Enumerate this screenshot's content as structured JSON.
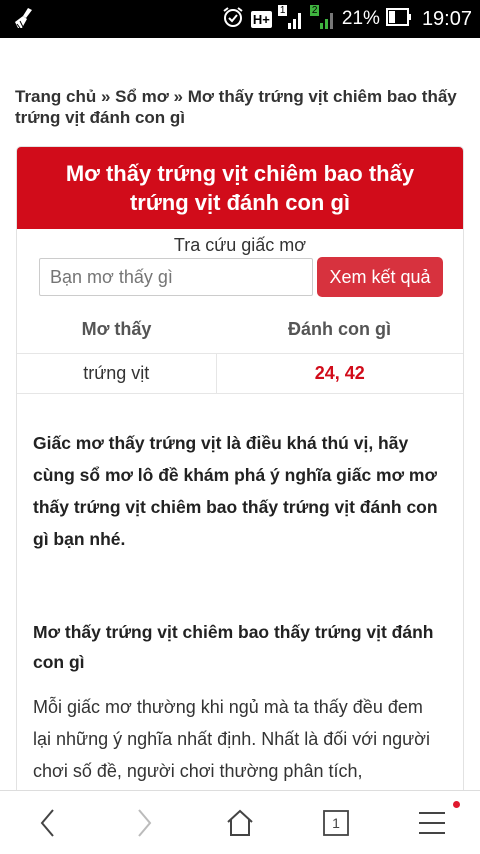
{
  "status_bar": {
    "network": "H+",
    "sim1": "1",
    "sim2": "2",
    "battery": "21%",
    "time": "19:07"
  },
  "breadcrumb": {
    "home": "Trang chủ",
    "sep1": " » ",
    "section": "Sổ mơ",
    "sep2": " » ",
    "current": "Mơ thấy trứng vịt chiêm bao thấy trứng vịt đánh con gì"
  },
  "card": {
    "title": "Mơ thấy trứng vịt chiêm bao thấy trứng vịt đánh con gì",
    "search_label": "Tra cứu giấc mơ",
    "search_placeholder": "Bạn mơ thấy gì",
    "search_button": "Xem kết quả"
  },
  "table": {
    "headers": [
      "Mơ thấy",
      "Đánh con gì"
    ],
    "rows": [
      {
        "dream": "trứng vịt",
        "numbers": "24, 42"
      }
    ]
  },
  "content": {
    "intro": "Giấc mơ thấy trứng vịt là điều khá thú vị, hãy cùng sổ mơ lô đề khám phá ý nghĩa giấc mơ mơ thấy trứng vịt chiêm bao thấy trứng vịt đánh con gì bạn nhé.",
    "subheading": "Mơ thấy trứng vịt chiêm bao thấy trứng vịt đánh con gì",
    "paragraph": "Mỗi giấc mơ thường khi ngủ mà ta thấy đều đem lại những ý nghĩa nhất định. Nhất là đối với người chơi số đề, người chơi thường phân tích,"
  },
  "bottom_nav": {
    "tab_count": "1",
    "icons": [
      "back-icon",
      "forward-icon",
      "home-icon",
      "tabs-icon",
      "menu-icon"
    ]
  },
  "colors": {
    "accent": "#d10c1a",
    "button": "#d7323e",
    "number": "#d10c1a"
  }
}
